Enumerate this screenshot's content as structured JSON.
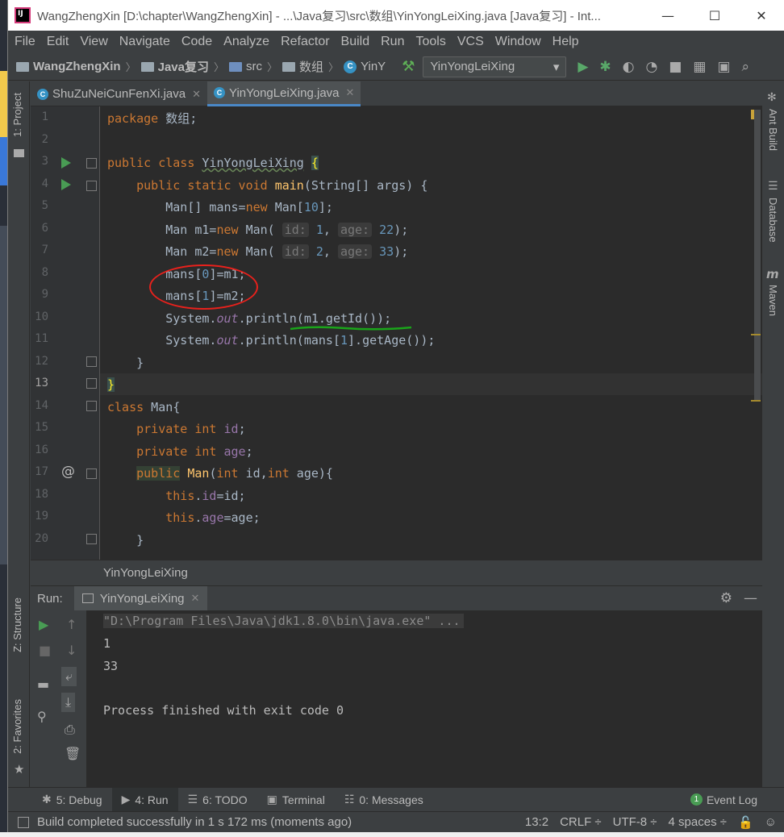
{
  "window": {
    "title": "WangZhengXin [D:\\chapter\\WangZhengXin] - ...\\Java复习\\src\\数组\\YinYongLeiXing.java [Java复习] - Int...",
    "minimize": "—",
    "maximize": "☐",
    "close": "✕"
  },
  "menu": [
    "File",
    "Edit",
    "View",
    "Navigate",
    "Code",
    "Analyze",
    "Refactor",
    "Build",
    "Run",
    "Tools",
    "VCS",
    "Window",
    "Help"
  ],
  "nav": {
    "project": "WangZhengXin",
    "module": "Java复习",
    "src": "src",
    "package": "数组",
    "cls": "YinY",
    "run_config": "YinYongLeiXing"
  },
  "left_tabs": {
    "project": "1: Project",
    "structure": "Z: Structure",
    "favorites": "2: Favorites"
  },
  "right_tabs": {
    "ant": "Ant Build",
    "database": "Database",
    "maven": "Maven"
  },
  "tabs": [
    {
      "label": "ShuZuNeiCunFenXi.java",
      "active": false
    },
    {
      "label": "YinYongLeiXing.java",
      "active": true
    }
  ],
  "line_numbers": [
    "1",
    "2",
    "3",
    "4",
    "5",
    "6",
    "7",
    "8",
    "9",
    "10",
    "11",
    "12",
    "13",
    "14",
    "15",
    "16",
    "17",
    "18",
    "19",
    "20"
  ],
  "editor_breadcrumb": "YinYongLeiXing",
  "run": {
    "label": "Run:",
    "tab": "YinYongLeiXing",
    "output": [
      "\"D:\\Program Files\\Java\\jdk1.8.0\\bin\\java.exe\" ...",
      "1",
      "33",
      "",
      "Process finished with exit code 0"
    ]
  },
  "bottom_tools": [
    {
      "label": "5: Debug"
    },
    {
      "label": "4: Run"
    },
    {
      "label": "6: TODO"
    },
    {
      "label": "Terminal"
    },
    {
      "label": "0: Messages"
    }
  ],
  "event_log": "Event Log",
  "event_log_count": "1",
  "status": {
    "message": "Build completed successfully in 1 s 172 ms (moments ago)",
    "position": "13:2",
    "line_sep": "CRLF ÷",
    "encoding": "UTF-8 ÷",
    "indent": "4 spaces ÷"
  },
  "colors": {
    "keyword": "#cc7832",
    "number": "#6897bb",
    "method": "#ffc66d",
    "field": "#9876aa",
    "run_green": "#499c54",
    "accent": "#4a88c7",
    "annotation_red": "#e8211c",
    "annotation_green": "#1aa51a"
  }
}
